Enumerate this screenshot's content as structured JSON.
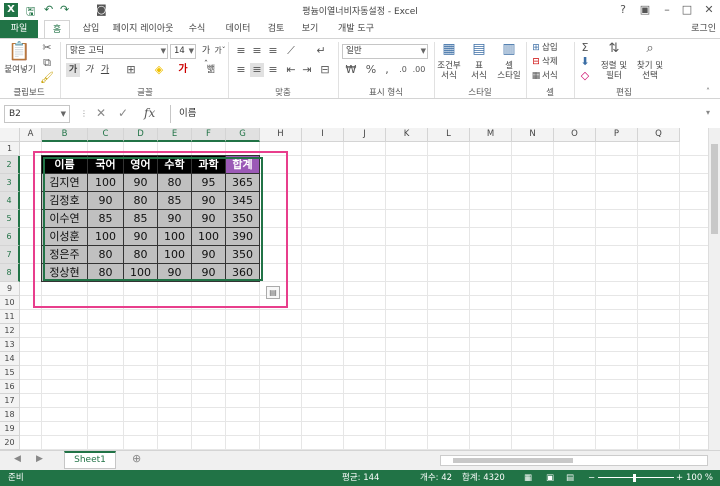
{
  "window": {
    "title": "평늄이열너비자동설정 - Excel",
    "login": "로그인"
  },
  "tabs": [
    {
      "label": "파일"
    },
    {
      "label": "홈"
    },
    {
      "label": "삽입"
    },
    {
      "label": "페이지 레이아웃"
    },
    {
      "label": "수식"
    },
    {
      "label": "데이터"
    },
    {
      "label": "검토"
    },
    {
      "label": "보기"
    },
    {
      "label": "개발 도구"
    }
  ],
  "ribbon": {
    "clipboard": {
      "paste": "붙여넣기",
      "label": "클립보드"
    },
    "font": {
      "name": "맑은 고딕",
      "size": "14",
      "label": "글꼴",
      "bold": "가",
      "italic": "가",
      "underline": "가"
    },
    "alignment": {
      "label": "맞춤"
    },
    "number": {
      "format": "일반",
      "percent": "%",
      "label": "표시 형식"
    },
    "styles": {
      "conditional": "조건부\n서식",
      "table": "표\n서식",
      "cell": "셀\n스타일",
      "label": "스타일"
    },
    "cells": {
      "insert": "삽입",
      "delete": "삭제",
      "format": "서식",
      "label": "셀"
    },
    "editing": {
      "sort": "정렬 및\n필터",
      "find": "찾기 및\n선택",
      "label": "편집"
    }
  },
  "formula_bar": {
    "name_box": "B2",
    "content": "이름"
  },
  "columns": [
    "A",
    "B",
    "C",
    "D",
    "E",
    "F",
    "G",
    "H",
    "I",
    "J",
    "K",
    "L",
    "M",
    "N",
    "O",
    "P",
    "Q"
  ],
  "rows": [
    "1",
    "2",
    "3",
    "4",
    "5",
    "6",
    "7",
    "8",
    "9",
    "10",
    "11",
    "12",
    "13",
    "14",
    "15",
    "16",
    "17",
    "18",
    "19",
    "20",
    "21",
    "22",
    "23"
  ],
  "table": {
    "headers": [
      "이름",
      "국어",
      "영어",
      "수학",
      "과학",
      "합계"
    ],
    "rows": [
      [
        "김지연",
        "100",
        "90",
        "80",
        "95",
        "365"
      ],
      [
        "김정호",
        "90",
        "80",
        "85",
        "90",
        "345"
      ],
      [
        "이수연",
        "85",
        "85",
        "90",
        "90",
        "350"
      ],
      [
        "이성훈",
        "100",
        "90",
        "100",
        "100",
        "390"
      ],
      [
        "정은주",
        "80",
        "80",
        "100",
        "90",
        "350"
      ],
      [
        "정상현",
        "80",
        "100",
        "90",
        "90",
        "360"
      ]
    ]
  },
  "sheets": [
    {
      "name": "Sheet1"
    }
  ],
  "status": {
    "ready": "준비",
    "average": "평균: 144",
    "count": "개수: 42",
    "sum": "합계: 4320",
    "zoom": "100 %"
  },
  "colors": {
    "accent": "#217346",
    "highlight": "#e83e8c",
    "total_header": "#9b59b6"
  }
}
